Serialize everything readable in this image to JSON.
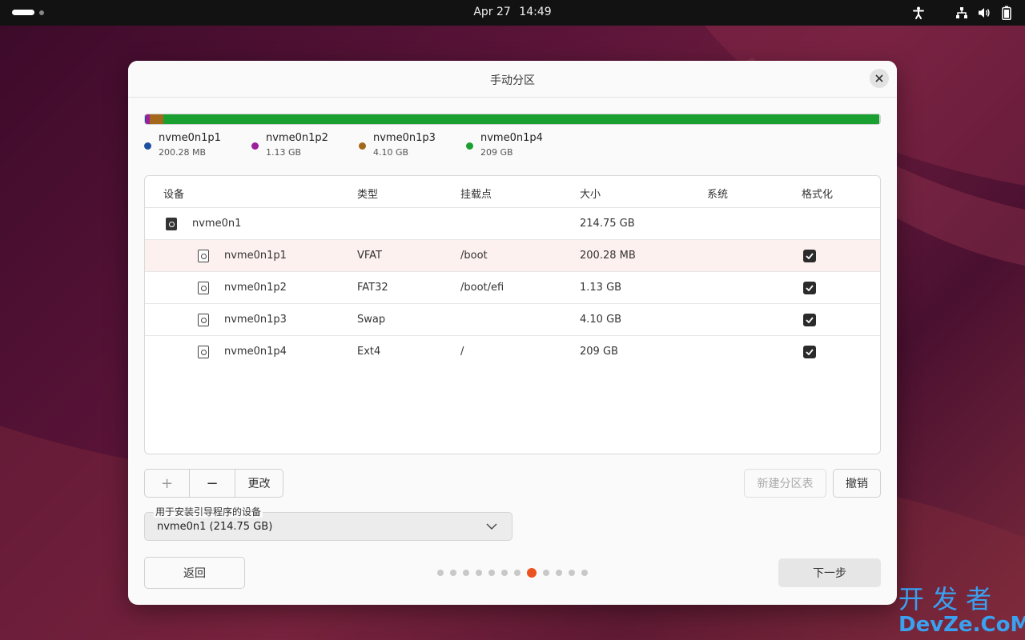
{
  "topbar": {
    "date": "Apr 27",
    "time": "14:49"
  },
  "dialog": {
    "title": "手动分区"
  },
  "usage": [
    {
      "name": "nvme0n1p1",
      "size": "200.28 MB",
      "color": "#1e4fa0",
      "fraction": 0.001
    },
    {
      "name": "nvme0n1p2",
      "size": "1.13 GB",
      "color": "#9c1f9c",
      "fraction": 0.0053
    },
    {
      "name": "nvme0n1p3",
      "size": "4.10 GB",
      "color": "#a3681b",
      "fraction": 0.0191
    },
    {
      "name": "nvme0n1p4",
      "size": "209 GB",
      "color": "#19a030",
      "fraction": 0.9733
    }
  ],
  "table": {
    "headers": [
      "设备",
      "类型",
      "挂载点",
      "大小",
      "系统",
      "格式化"
    ],
    "disk": {
      "name": "nvme0n1",
      "size": "214.75 GB"
    },
    "partitions": [
      {
        "device": "nvme0n1p1",
        "type": "VFAT",
        "mount": "/boot",
        "size": "200.28 MB",
        "system": "",
        "format": true
      },
      {
        "device": "nvme0n1p2",
        "type": "FAT32",
        "mount": "/boot/efi",
        "size": "1.13 GB",
        "system": "",
        "format": true
      },
      {
        "device": "nvme0n1p3",
        "type": "Swap",
        "mount": "",
        "size": "4.10 GB",
        "system": "",
        "format": true
      },
      {
        "device": "nvme0n1p4",
        "type": "Ext4",
        "mount": "/",
        "size": "209 GB",
        "system": "",
        "format": true
      }
    ]
  },
  "buttons": {
    "add": "+",
    "remove": "−",
    "change": "更改",
    "new_table": "新建分区表",
    "revert": "撤销",
    "back": "返回",
    "next": "下一步"
  },
  "bootloader": {
    "label": "用于安装引导程序的设备",
    "value": "nvme0n1  (214.75 GB)"
  },
  "pager": {
    "total": 12,
    "current": 8
  },
  "watermark": {
    "line1": "开发者",
    "line2": "DevZe.CoM"
  }
}
